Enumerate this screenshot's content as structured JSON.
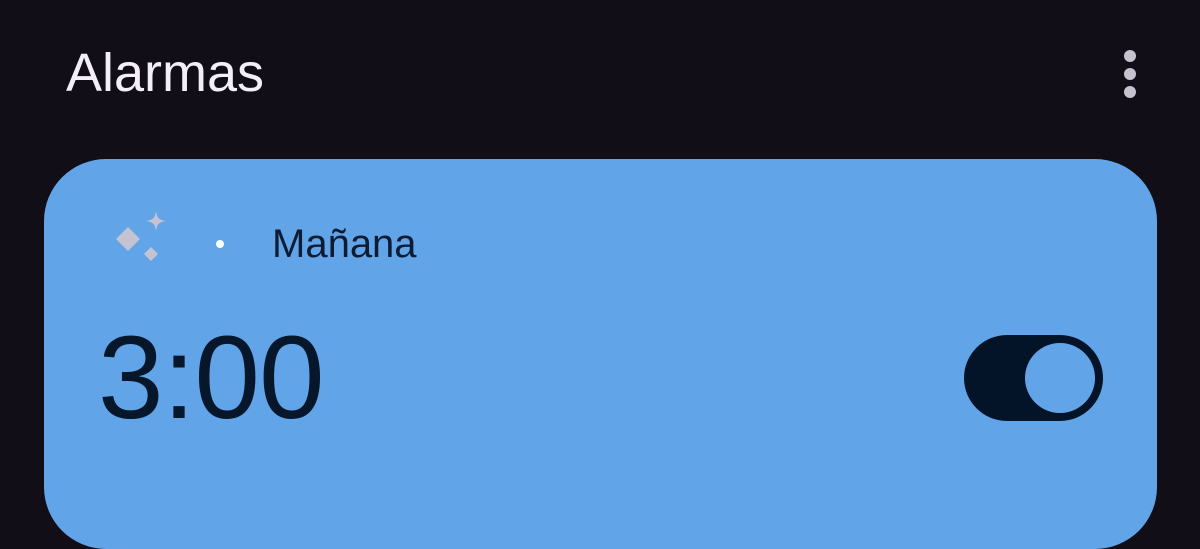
{
  "header": {
    "title": "Alarmas",
    "menu_icon": "more-vert-icon"
  },
  "alarm": {
    "label_icon": "sparkle-icon",
    "day": "Mañana",
    "time": "3:00",
    "enabled": true
  },
  "colors": {
    "background": "#110e17",
    "card": "#62a4e8",
    "toggle_track": "#031428",
    "title_text": "#f3eef8"
  }
}
